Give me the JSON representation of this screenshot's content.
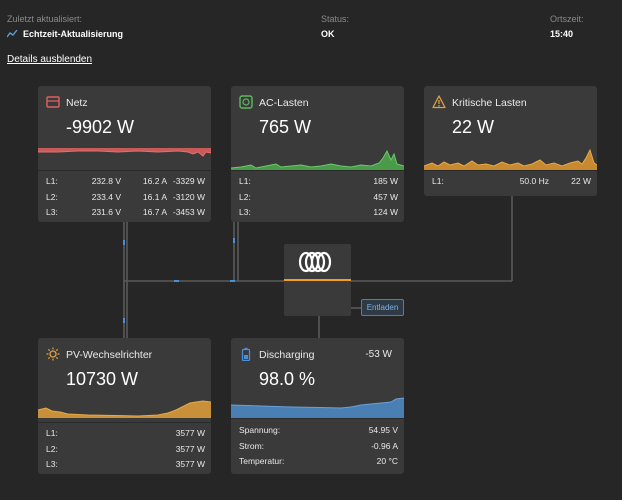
{
  "header": {
    "updated_label": "Zuletzt aktualisiert:",
    "updated_value": "Echtzeit-Aktualisierung",
    "status_label": "Status:",
    "status_value": "OK",
    "time_label": "Ortszeit:",
    "time_value": "15:40"
  },
  "details_link": "Details ausblenden",
  "colors": {
    "grid": "#d96a6a",
    "ac": "#5cb85c",
    "critical": "#e0a040",
    "pv": "#d8a040",
    "battery": "#4a80b8"
  },
  "grid": {
    "title": "Netz",
    "value": "-9902 W",
    "rows": [
      {
        "phase": "L1:",
        "voltage": "232.8 V",
        "current": "16.2 A",
        "power": "-3329 W"
      },
      {
        "phase": "L2:",
        "voltage": "233.4 V",
        "current": "16.1 A",
        "power": "-3120 W"
      },
      {
        "phase": "L3:",
        "voltage": "231.6 V",
        "current": "16.7 A",
        "power": "-3453 W"
      }
    ]
  },
  "ac_loads": {
    "title": "AC-Lasten",
    "value": "765 W",
    "rows": [
      {
        "phase": "L1:",
        "power": "185 W"
      },
      {
        "phase": "L2:",
        "power": "457 W"
      },
      {
        "phase": "L3:",
        "power": "124 W"
      }
    ]
  },
  "critical": {
    "title": "Kritische Lasten",
    "value": "22 W",
    "rows": [
      {
        "phase": "L1:",
        "freq": "50.0 Hz",
        "power": "22 W"
      }
    ]
  },
  "pv": {
    "title": "PV-Wechselrichter",
    "value": "10730 W",
    "rows": [
      {
        "phase": "L1:",
        "power": "3577 W"
      },
      {
        "phase": "L2:",
        "power": "3577 W"
      },
      {
        "phase": "L3:",
        "power": "3577 W"
      }
    ]
  },
  "battery": {
    "title": "Discharging",
    "power": "-53 W",
    "value": "98.0 %",
    "rows": [
      {
        "label": "Spannung:",
        "value": "54.95 V"
      },
      {
        "label": "Strom:",
        "value": "-0.96 A"
      },
      {
        "label": "Temperatur:",
        "value": "20 °C"
      }
    ]
  },
  "inverter": {
    "mode_button": "Entladen"
  }
}
